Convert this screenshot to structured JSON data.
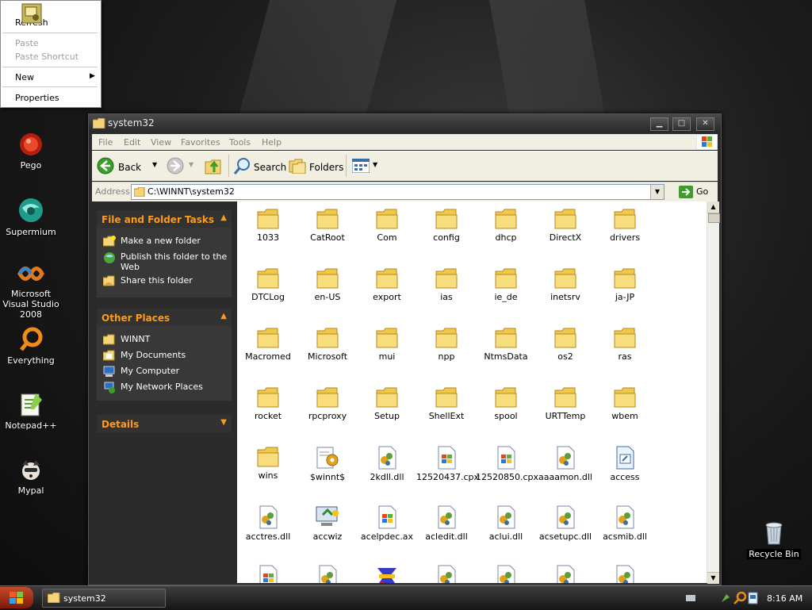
{
  "desktop": {
    "icons": [
      {
        "label": "Pego",
        "icon": "pego-icon"
      },
      {
        "label": "Supermium",
        "icon": "supermium-icon"
      },
      {
        "label": "Microsoft Visual Studio 2008",
        "icon": "visual-studio-icon"
      },
      {
        "label": "Everything",
        "icon": "everything-search-icon"
      },
      {
        "label": "Notepad++",
        "icon": "notepad-plus-plus-icon"
      },
      {
        "label": "Mypal",
        "icon": "mypal-icon"
      }
    ],
    "recycle_bin": {
      "label": "Recycle Bin",
      "icon": "recycle-bin-icon"
    }
  },
  "context_menu": {
    "items": [
      {
        "label": "Refresh",
        "enabled": true
      },
      {
        "label": "Paste",
        "enabled": false
      },
      {
        "label": "Paste Shortcut",
        "enabled": false
      },
      {
        "label": "New",
        "enabled": true,
        "submenu": true
      },
      {
        "label": "Properties",
        "enabled": true
      }
    ]
  },
  "window": {
    "title": "system32",
    "menu": [
      "File",
      "Edit",
      "View",
      "Favorites",
      "Tools",
      "Help"
    ],
    "toolbar": {
      "back": "Back",
      "search": "Search",
      "folders": "Folders"
    },
    "address": {
      "label": "Address",
      "value": "C:\\WINNT\\system32",
      "go": "Go"
    },
    "tasks": {
      "title": "File and Folder Tasks",
      "items": [
        "Make a new folder",
        "Publish this folder to the Web",
        "Share this folder"
      ]
    },
    "other_places": {
      "title": "Other Places",
      "items": [
        "WINNT",
        "My Documents",
        "My Computer",
        "My Network Places"
      ]
    },
    "details": {
      "title": "Details"
    },
    "files": [
      {
        "name": "1033",
        "type": "folder"
      },
      {
        "name": "CatRoot",
        "type": "folder"
      },
      {
        "name": "Com",
        "type": "folder"
      },
      {
        "name": "config",
        "type": "folder"
      },
      {
        "name": "dhcp",
        "type": "folder"
      },
      {
        "name": "DirectX",
        "type": "folder"
      },
      {
        "name": "drivers",
        "type": "folder"
      },
      {
        "name": "DTCLog",
        "type": "folder"
      },
      {
        "name": "en-US",
        "type": "folder"
      },
      {
        "name": "export",
        "type": "folder"
      },
      {
        "name": "ias",
        "type": "folder"
      },
      {
        "name": "ie_de",
        "type": "folder"
      },
      {
        "name": "inetsrv",
        "type": "folder"
      },
      {
        "name": "ja-JP",
        "type": "folder"
      },
      {
        "name": "Macromed",
        "type": "folder"
      },
      {
        "name": "Microsoft",
        "type": "folder"
      },
      {
        "name": "mui",
        "type": "folder"
      },
      {
        "name": "npp",
        "type": "folder"
      },
      {
        "name": "NtmsData",
        "type": "folder"
      },
      {
        "name": "os2",
        "type": "folder"
      },
      {
        "name": "ras",
        "type": "folder"
      },
      {
        "name": "rocket",
        "type": "folder"
      },
      {
        "name": "rpcproxy",
        "type": "folder"
      },
      {
        "name": "Setup",
        "type": "folder"
      },
      {
        "name": "ShellExt",
        "type": "folder"
      },
      {
        "name": "spool",
        "type": "folder"
      },
      {
        "name": "URTTemp",
        "type": "folder"
      },
      {
        "name": "wbem",
        "type": "folder"
      },
      {
        "name": "wins",
        "type": "folder"
      },
      {
        "name": "$winnt$",
        "type": "settings"
      },
      {
        "name": "2kdll.dll",
        "type": "dll"
      },
      {
        "name": "12520437.cpx",
        "type": "winfile"
      },
      {
        "name": "12520850.cpx",
        "type": "winfile"
      },
      {
        "name": "aaaamon.dll",
        "type": "dll"
      },
      {
        "name": "access",
        "type": "app"
      },
      {
        "name": "acctres.dll",
        "type": "dll"
      },
      {
        "name": "accwiz",
        "type": "wizard"
      },
      {
        "name": "acelpdec.ax",
        "type": "winfile"
      },
      {
        "name": "acledit.dll",
        "type": "dll"
      },
      {
        "name": "aclui.dll",
        "type": "dll"
      },
      {
        "name": "acsetupc.dll",
        "type": "dll"
      },
      {
        "name": "acsmib.dll",
        "type": "dll"
      },
      {
        "name": "",
        "type": "winfile"
      },
      {
        "name": "",
        "type": "dll"
      },
      {
        "name": "",
        "type": "tools"
      },
      {
        "name": "",
        "type": "dll"
      },
      {
        "name": "",
        "type": "dll"
      },
      {
        "name": "",
        "type": "dll"
      },
      {
        "name": "",
        "type": "dll"
      }
    ]
  },
  "taskbar": {
    "task": "system32",
    "clock": "8:16 AM"
  }
}
